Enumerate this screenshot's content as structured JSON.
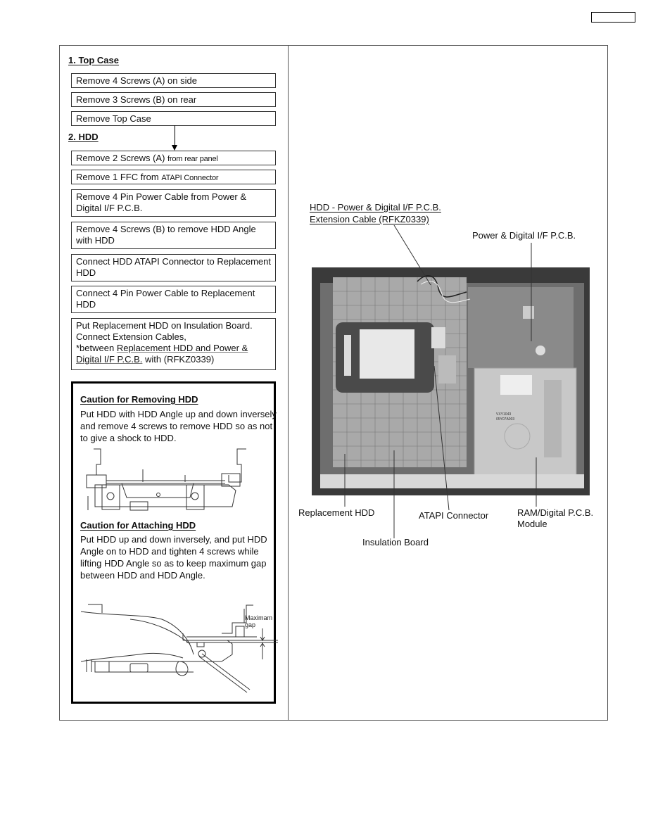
{
  "page_id": "",
  "left_column": {
    "section1": {
      "heading": "1. Top Case",
      "steps": [
        {
          "text": "Remove 4 Screws (A) on side"
        },
        {
          "text": "Remove 3 Screws (B) on rear"
        },
        {
          "text": "Remove Top Case"
        }
      ]
    },
    "section2": {
      "heading": "2. HDD",
      "steps": [
        {
          "main": "Remove 2 Screws (A) ",
          "small": "from rear panel"
        },
        {
          "main": "Remove 1 FFC from ",
          "small": "ATAPI Connector"
        },
        {
          "text": "Remove 4 Pin Power Cable from Power & Digital I/F P.C.B."
        },
        {
          "text": "Remove 4 Screws (B) to remove HDD Angle with HDD"
        },
        {
          "text": "Connect HDD ATAPI Connector to Replacement HDD"
        },
        {
          "text": "Connect 4 Pin Power Cable to Replacement HDD"
        },
        {
          "line1": "Put Replacement HDD on Insulation Board.",
          "line2": "Connect Extension Cables,",
          "line3_prefix": "*between ",
          "line3_underlined": "Replacement HDD and Power &",
          "line4_underlined": "Digital I/F P.C.B.",
          "line4_suffix": " with (RFKZ0339)"
        }
      ]
    },
    "caution_removing": {
      "title": "Caution for Removing HDD",
      "text": "Put HDD with HDD Angle up and down inversely  and remove 4 screws to remove HDD so as not to give a shock to HDD."
    },
    "caution_attaching": {
      "title": "Caution for Attaching HDD",
      "text": "Put HDD up and down inversely, and put HDD Angle on to HDD and tighten 4 screws while lifting HDD Angle so as to keep maximum gap between HDD and HDD Angle.",
      "gap_label_line1": "Maximam",
      "gap_label_line2": "gap"
    }
  },
  "right_column": {
    "callouts": {
      "extension_cable_line1": "HDD - Power & Digital I/F P.C.B.",
      "extension_cable_line2": "Extension Cable (RFKZ0339)",
      "power_pcb": "Power & Digital I/F P.C.B.",
      "replacement_hdd": "Replacement HDD",
      "insulation_board": "Insulation Board",
      "atapi_connector": "ATAPI Connector",
      "ram_module_line1": "RAM/Digital P.C.B.",
      "ram_module_line2": "Module"
    },
    "photo_text": {
      "drive_label_line1": "VXY1043",
      "drive_label_line2": "05Y07A003"
    }
  }
}
